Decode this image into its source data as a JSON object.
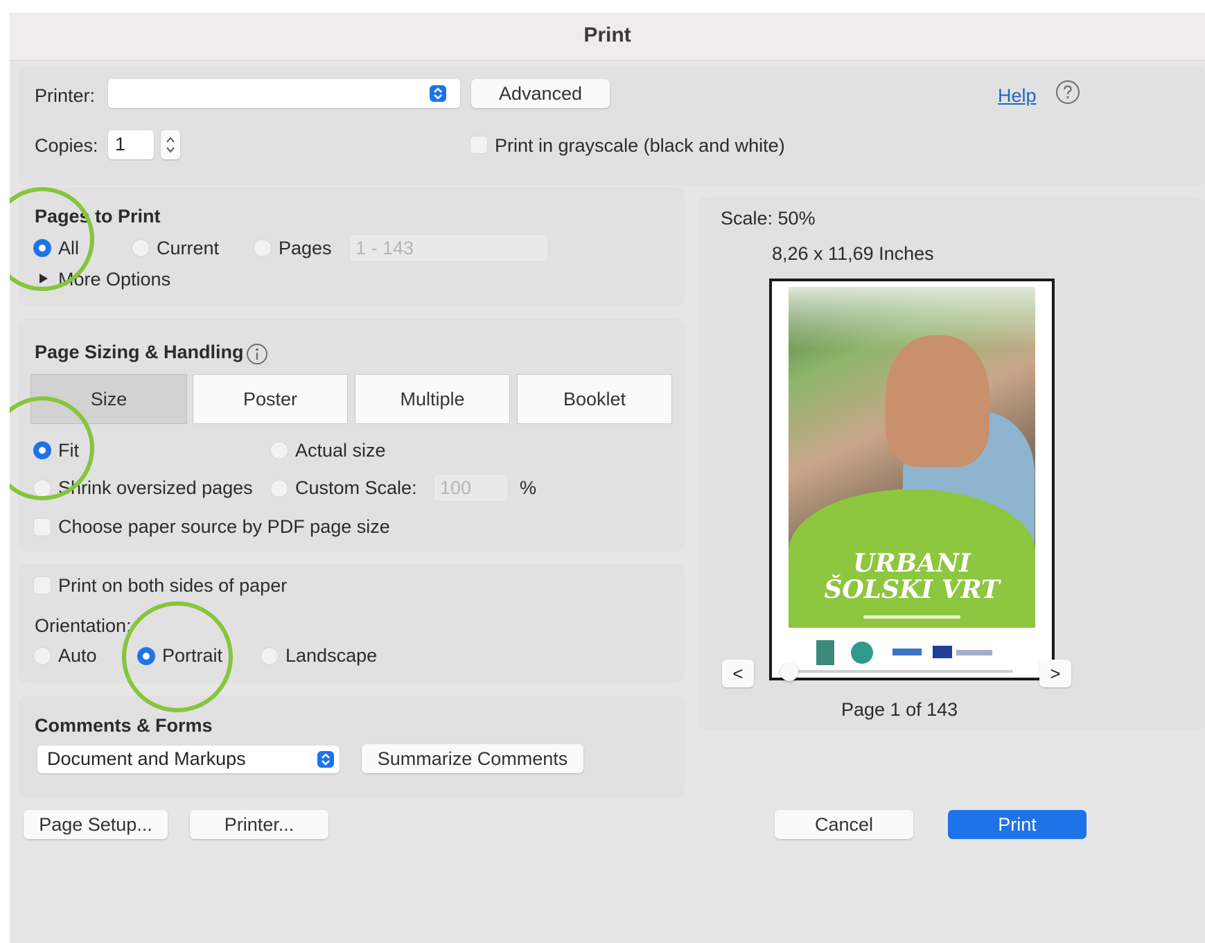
{
  "dialog": {
    "title": "Print"
  },
  "printer": {
    "label": "Printer:",
    "value": "",
    "advanced_button": "Advanced",
    "help_link": "Help"
  },
  "copies": {
    "label": "Copies:",
    "value": "1"
  },
  "grayscale": {
    "label": "Print in grayscale (black and white)",
    "checked": false
  },
  "pages_to_print": {
    "heading": "Pages to Print",
    "options": [
      "All",
      "Current",
      "Pages"
    ],
    "selected": "All",
    "range_placeholder": "1 - 143",
    "more_options": "More Options"
  },
  "sizing": {
    "heading": "Page Sizing & Handling",
    "tabs": [
      "Size",
      "Poster",
      "Multiple",
      "Booklet"
    ],
    "active_tab": "Size",
    "fit": "Fit",
    "actual_size": "Actual size",
    "shrink": "Shrink oversized pages",
    "custom_scale": "Custom Scale:",
    "custom_scale_value": "100",
    "percent": "%",
    "paper_source": "Choose paper source by PDF page size",
    "selected": "Fit"
  },
  "duplex": {
    "label": "Print on both sides of paper",
    "checked": false
  },
  "orientation": {
    "label": "Orientation:",
    "options": [
      "Auto",
      "Portrait",
      "Landscape"
    ],
    "selected": "Portrait"
  },
  "comments_forms": {
    "heading": "Comments & Forms",
    "value": "Document and Markups",
    "summarize_button": "Summarize Comments"
  },
  "preview": {
    "scale": "Scale:  50%",
    "dimensions": "8,26 x 11,69 Inches",
    "cover_title_line1": "URBANI",
    "cover_title_line2": "ŠOLSKI VRT",
    "prev": "<",
    "next": ">",
    "page_indicator": "Page 1 of 143",
    "page_position": 0.0
  },
  "footer": {
    "page_setup": "Page Setup...",
    "printer": "Printer...",
    "cancel": "Cancel",
    "print": "Print"
  },
  "colors": {
    "accent": "#1e73e8",
    "highlight_circle": "#86c53c",
    "cover_green": "#8dc63f"
  }
}
